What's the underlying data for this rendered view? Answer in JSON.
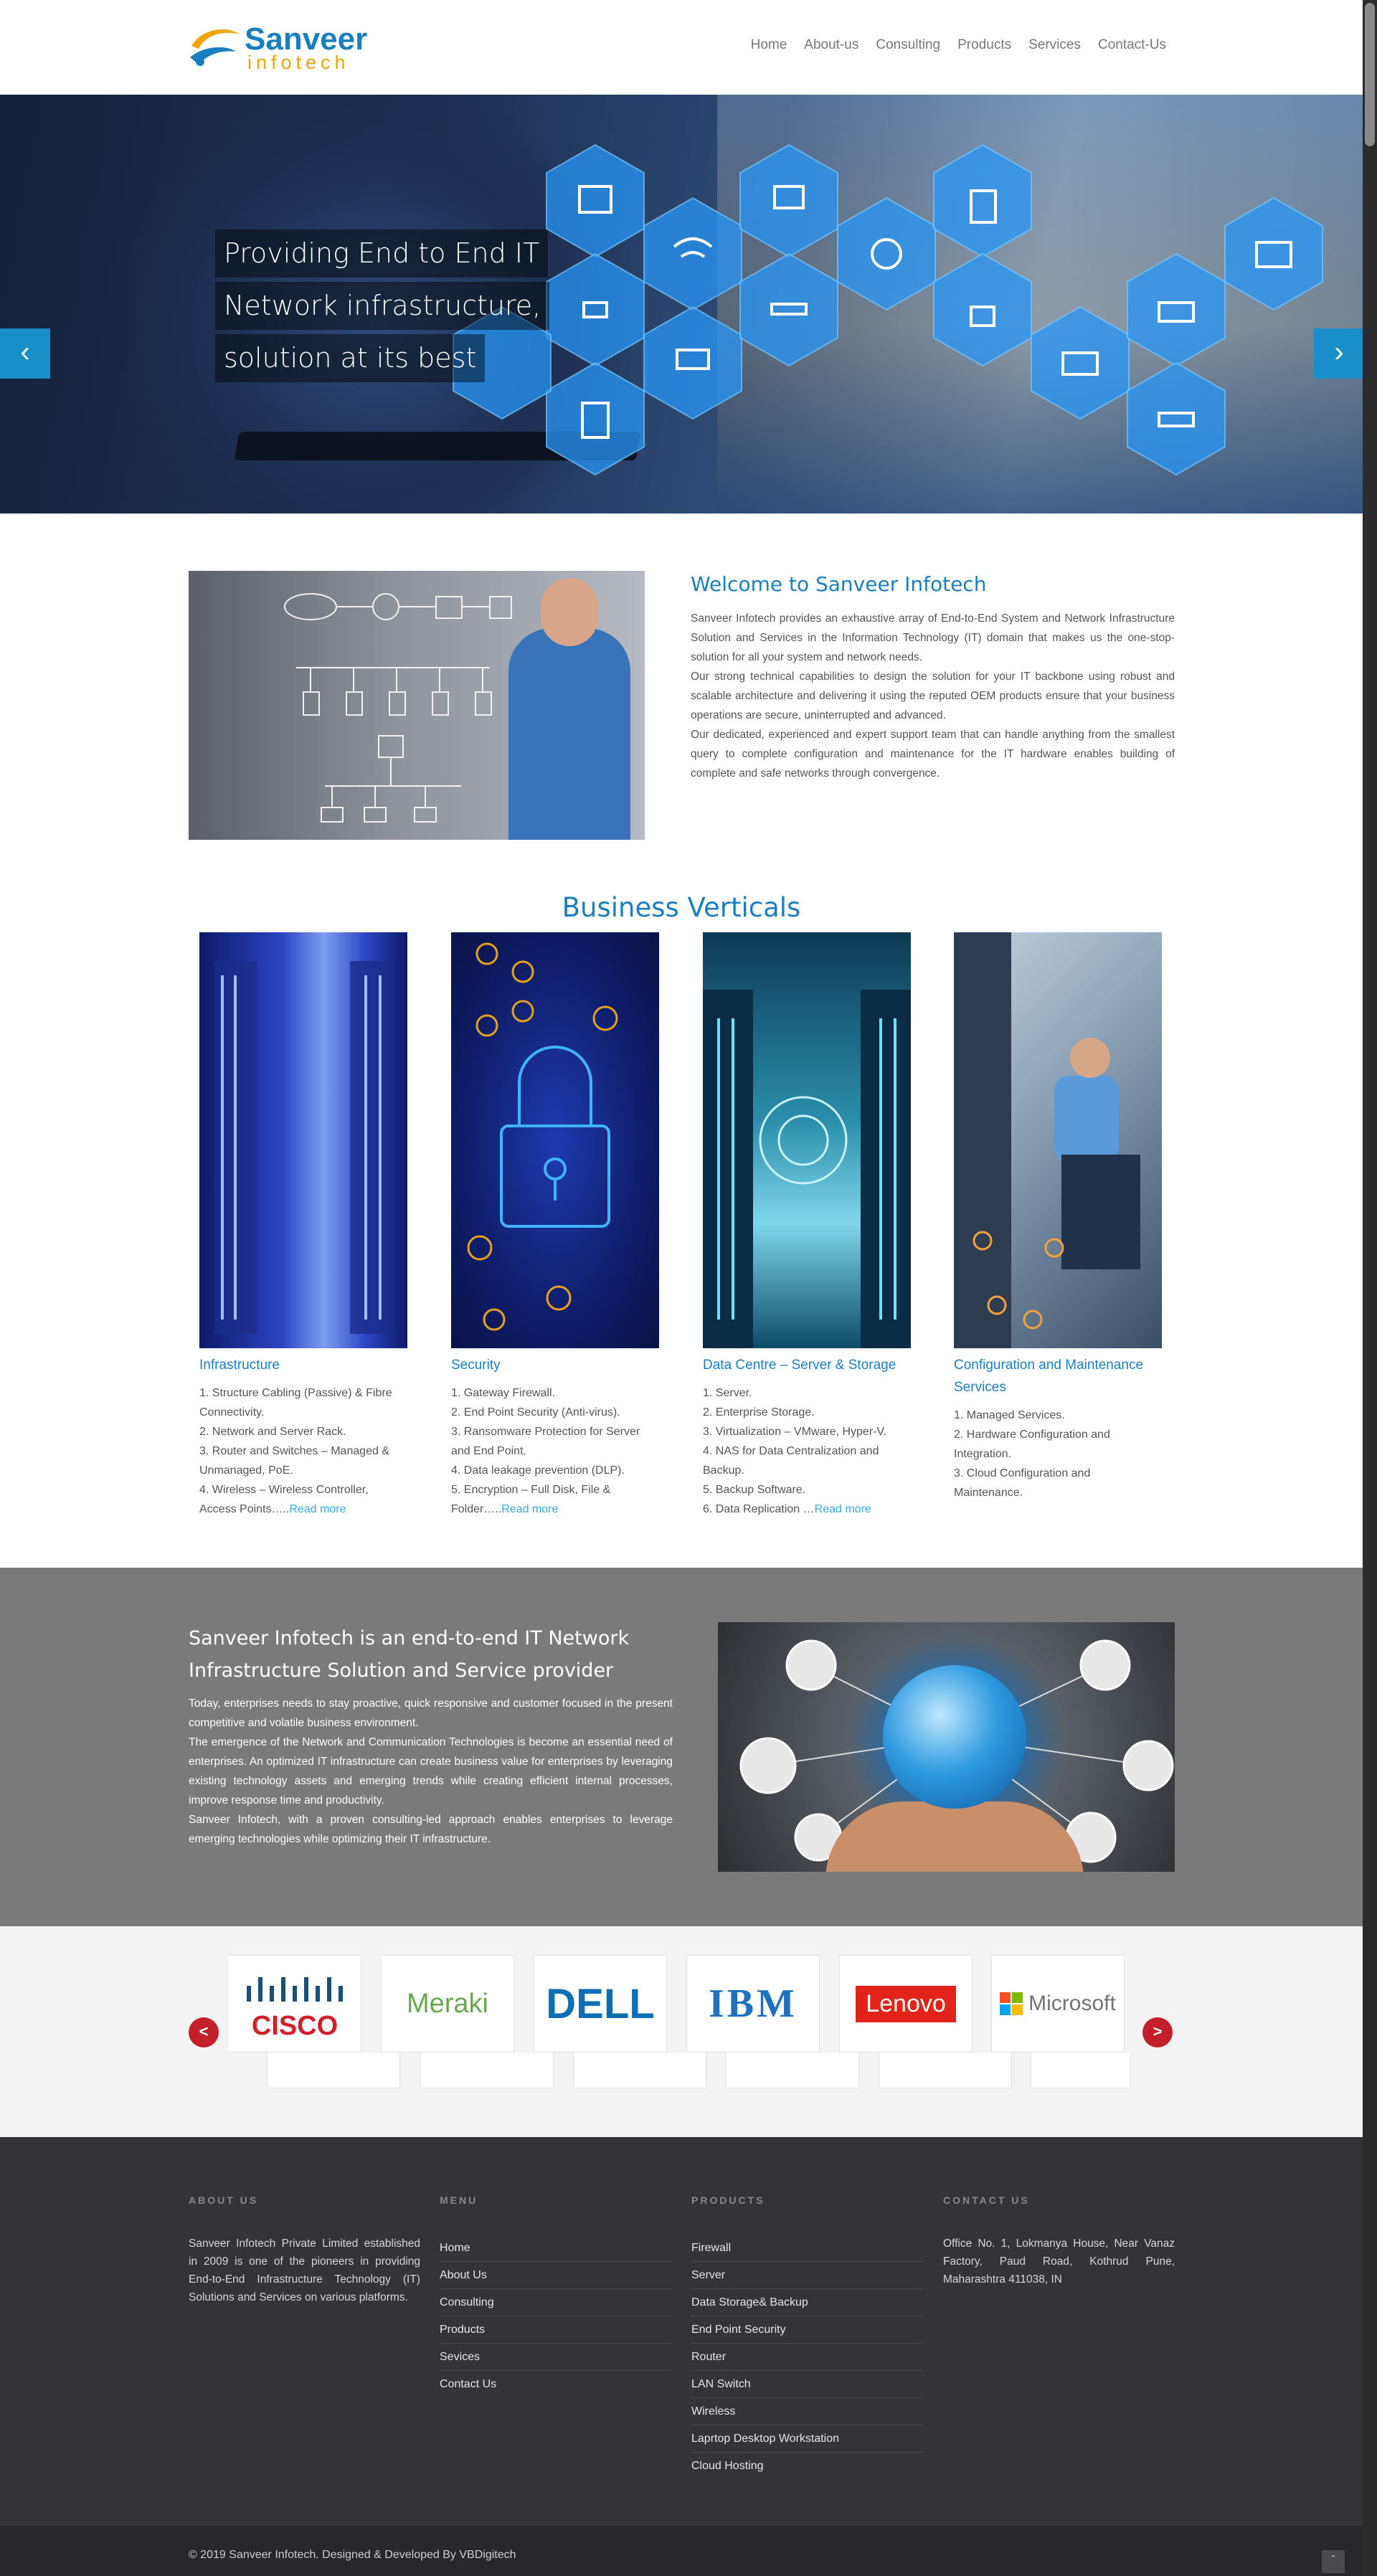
{
  "header": {
    "logo_name": "Sanveer",
    "logo_sub": "infotech",
    "nav": [
      "Home",
      "About-us",
      "Consulting",
      "Products",
      "Services",
      "Contact-Us"
    ]
  },
  "hero": {
    "caption_lines": [
      "Providing End to End IT",
      "Network infrastructure,",
      "solution at its best"
    ],
    "prev_icon": "chevron-left-icon",
    "next_icon": "chevron-right-icon"
  },
  "welcome": {
    "title": "Welcome to Sanveer Infotech",
    "paragraphs": [
      "Sanveer Infotech provides an exhaustive array of End-to-End System and Network Infrastructure Solution and Services in the Information Technology (IT) domain that makes us the one-stop-solution for all your system and network needs.",
      "Our strong technical capabilities to design the solution for your IT backbone using robust and scalable architecture and delivering it using the reputed OEM products ensure that your business operations are secure, uninterrupted and advanced.",
      "Our dedicated, experienced and expert support team that can handle anything from the smallest query to complete configuration and maintenance for the IT hardware enables building of complete and safe networks through convergence."
    ]
  },
  "verticals": {
    "title": "Business Verticals",
    "read_more": "Read more",
    "items": [
      {
        "title": "Infrastructure",
        "lines": [
          "1. Structure Cabling (Passive) & Fibre Connectivity.",
          "2. Network and Server Rack.",
          "3. Router and Switches – Managed & Unmanaged, PoE.",
          "4. Wireless – Wireless Controller, Access Points….."
        ],
        "more": true
      },
      {
        "title": "Security",
        "lines": [
          "1. Gateway Firewall.",
          "2. End Point Security (Anti-virus).",
          "3. Ransomware Protection for Server and End Point.",
          "4. Data leakage prevention (DLP).",
          "5. Encryption – Full Disk, File & Folder….."
        ],
        "more": true
      },
      {
        "title": "Data Centre – Server & Storage",
        "lines": [
          "1. Server.",
          "2. Enterprise Storage.",
          "3. Virtualization – VMware, Hyper-V.",
          "4. NAS for Data Centralization and Backup.",
          "5. Backup Software.",
          "6. Data Replication …"
        ],
        "more": true
      },
      {
        "title": "Configuration and Maintenance Services",
        "lines": [
          "1. Managed Services.",
          "2. Hardware Configuration and Integration.",
          "3. Cloud Configuration and Maintenance."
        ],
        "more": false
      }
    ]
  },
  "provider": {
    "title": "Sanveer Infotech is an end-to-end IT Network Infrastructure Solution and Service provider",
    "paragraphs": [
      "Today, enterprises needs to stay proactive, quick responsive and customer focused in the present competitive and volatile business environment.",
      "The emergence of the Network and Communication Technologies is become an essential need of enterprises. An optimized IT infrastructure can create business value for enterprises by leveraging existing technology assets and emerging trends while creating efficient internal processes, improve response time and productivity.",
      "Sanveer Infotech, with a proven consulting-led approach enables enterprises to leverage emerging technologies while optimizing their IT infrastructure."
    ]
  },
  "clients": {
    "prev": "<",
    "next": ">",
    "logos": [
      "CISCO",
      "Meraki",
      "DELL",
      "IBM",
      "Lenovo",
      "Microsoft"
    ]
  },
  "footer": {
    "about_title": "ABOUT US",
    "about_text": "Sanveer Infotech Private Limited established in 2009 is one of the pioneers in providing End-to-End Infrastructure Technology (IT) Solutions and Services on various platforms.",
    "menu_title": "MENU",
    "menu": [
      "Home",
      "About Us",
      "Consulting",
      "Products",
      "Sevices",
      "Contact Us"
    ],
    "products_title": "PRODUCTS",
    "products": [
      "Firewall",
      "Server",
      "Data Storage& Backup",
      "End Point Security",
      "Router",
      "LAN Switch",
      "Wireless",
      "Laprtop Desktop Workstation",
      "Cloud Hosting"
    ],
    "contact_title": "CONTACT US",
    "contact_text": "Office No. 1, Lokmanya House, Near Vanaz Factory, Paud Road, Kothrud Pune, Maharashtra 411038, IN",
    "copyright": "© 2019 Sanveer Infotech. Designed & Developed By VBDigitech",
    "totop_icon": "chevron-up-icon"
  },
  "colors": {
    "brand_blue": "#1a7fc1",
    "accent_orange": "#f0a500",
    "client_red": "#c21f2a"
  }
}
